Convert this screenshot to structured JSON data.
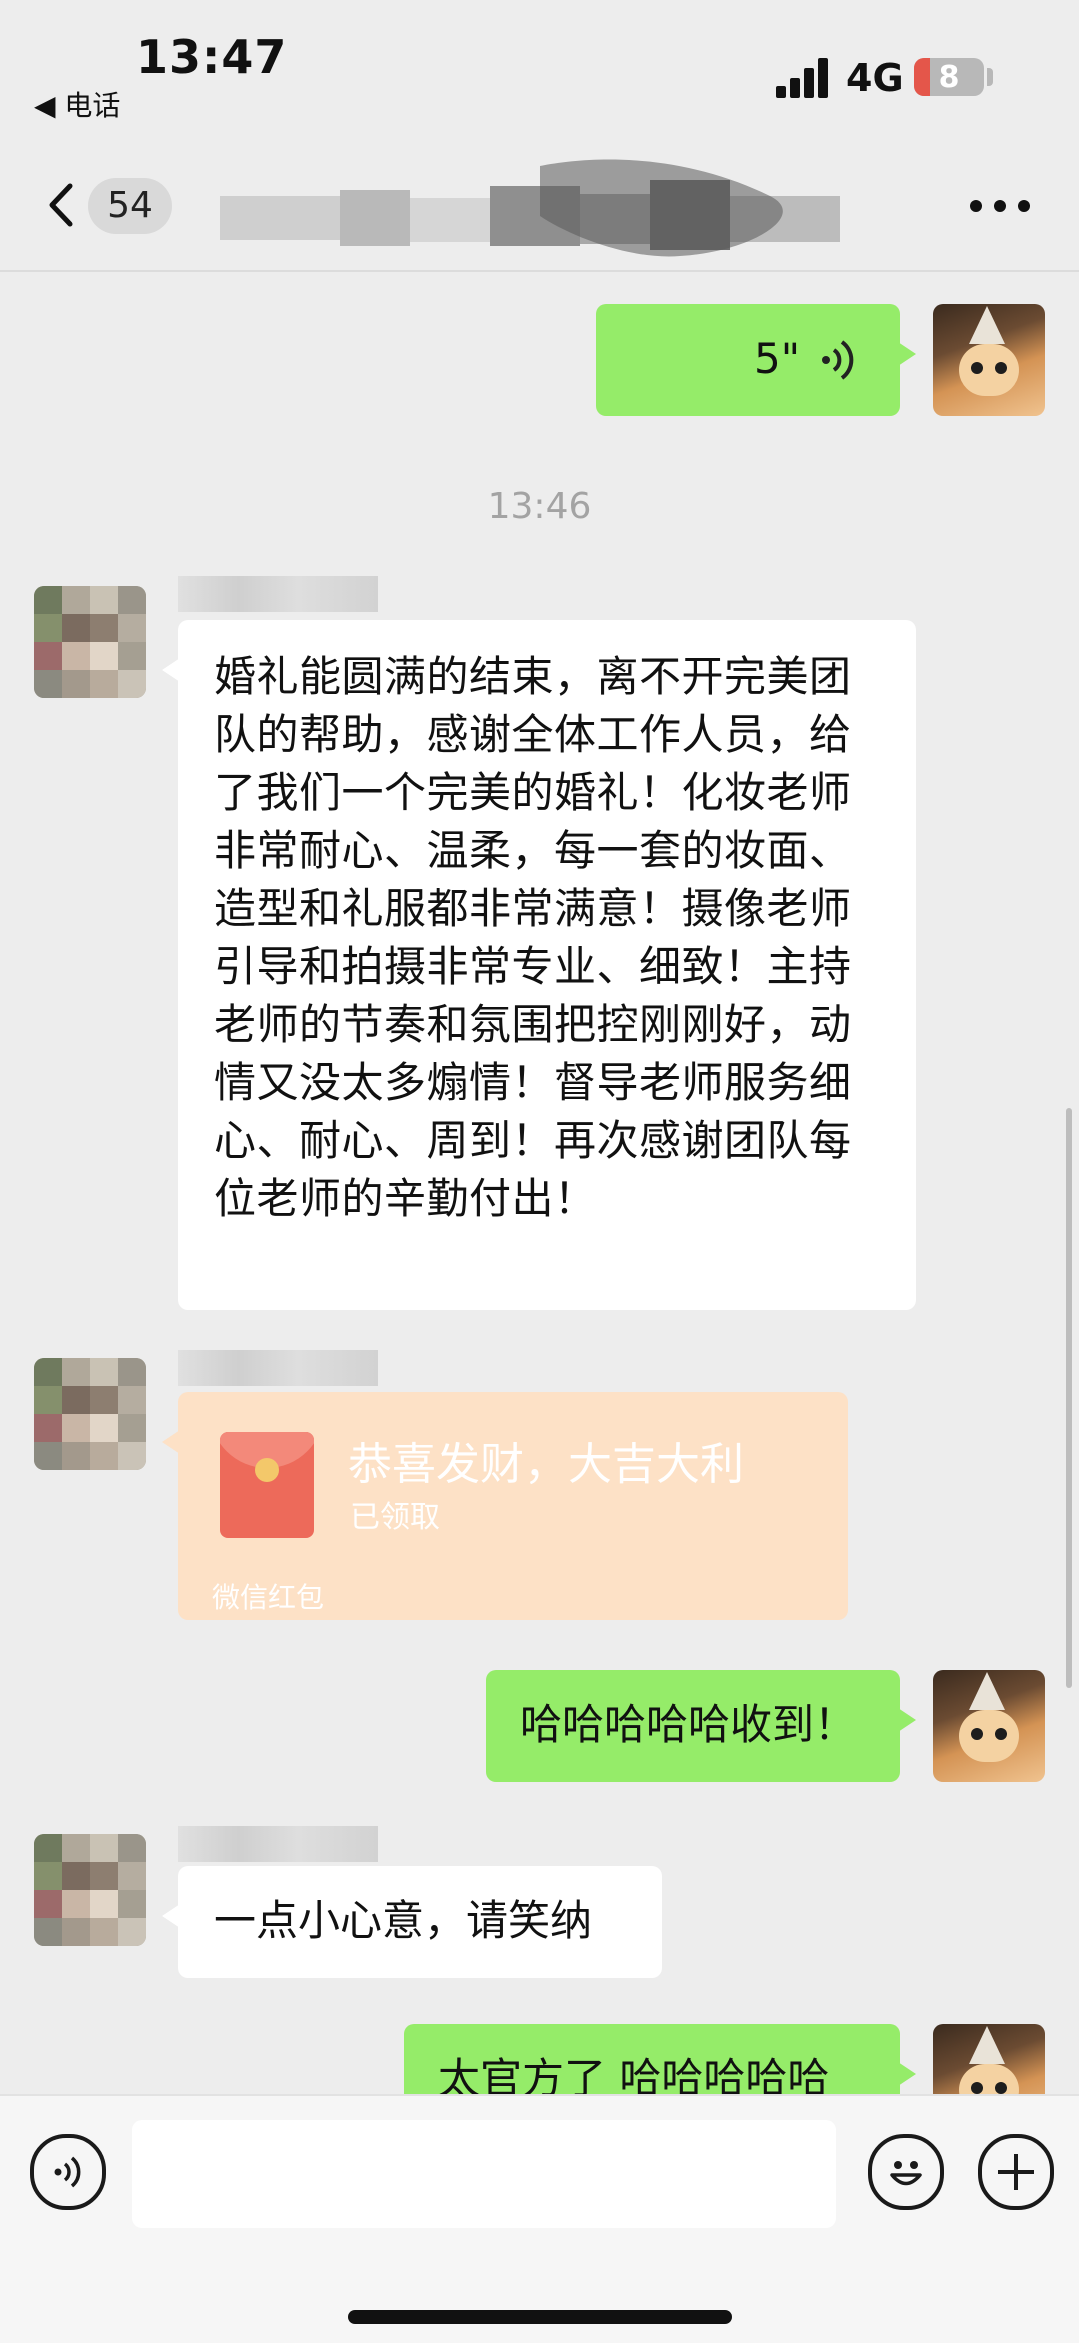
{
  "status_bar": {
    "time": "13:47",
    "back_to_app": "◀ 电话",
    "network": "4G",
    "battery": "8"
  },
  "nav": {
    "unread_count": "54"
  },
  "messages": {
    "voice": {
      "duration": "5\""
    },
    "time_separator": "13:46",
    "review": {
      "text": "婚礼能圆满的结束，离不开完美团队的帮助，感谢全体工作人员，给了我们一个完美的婚礼！化妆老师非常耐心、温柔，每一套的妆面、造型和礼服都非常满意！摄像老师引导和拍摄非常专业、细致！主持老师的节奏和氛围把控刚刚好，动情又没太多煽情！督导老师服务细心、耐心、周到！再次感谢团队每位老师的辛勤付出！"
    },
    "red_packet": {
      "title": "恭喜发财，大吉大利",
      "status": "已领取",
      "footer": "微信红包"
    },
    "reply_1": "哈哈哈哈哈收到！",
    "reply_2": "一点小心意，请笑纳",
    "reply_3": "太官方了 哈哈哈哈哈"
  },
  "colors": {
    "chat_bg": "#ededed",
    "bubble_green": "#95ec69",
    "bubble_white": "#ffffff",
    "red_packet_bg": "#fde1c6"
  },
  "icons": [
    "back-chevron-icon",
    "more-icon",
    "voice-wave-icon",
    "voice-mode-icon",
    "emoji-icon",
    "plus-icon",
    "red-packet-icon"
  ]
}
